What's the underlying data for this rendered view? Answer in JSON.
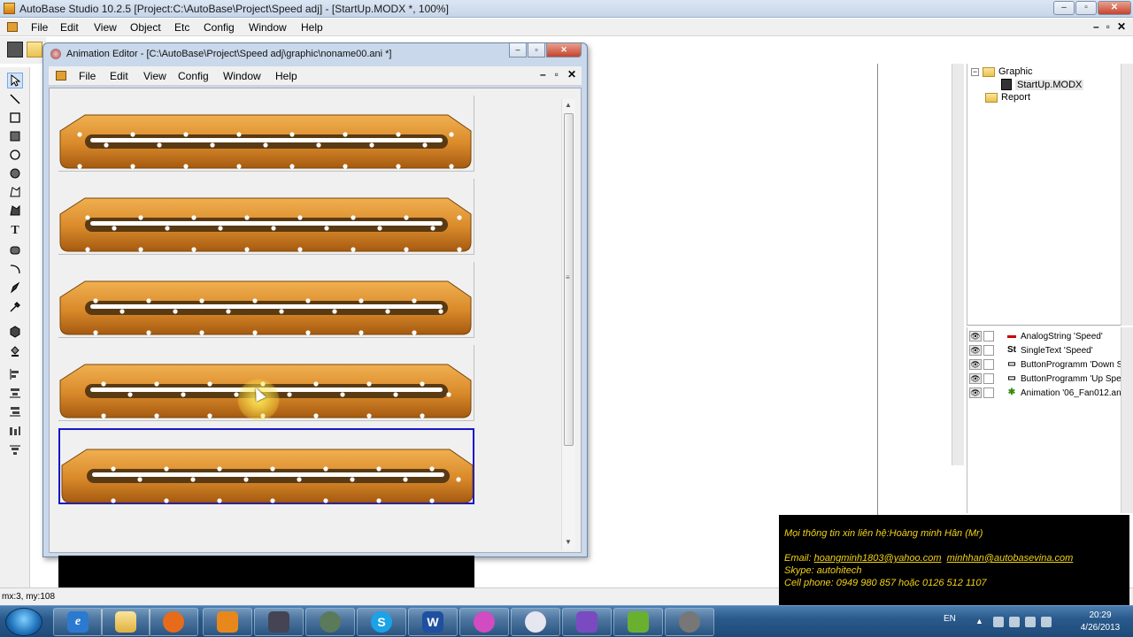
{
  "main_window": {
    "title": "AutoBase Studio 10.2.5 [Project:C:\\AutoBase\\Project\\Speed adj] - [StartUp.MODX *, 100%]",
    "controls": {
      "minimize": "–",
      "maximize": "▫",
      "close": "✕"
    }
  },
  "main_menu": {
    "items": [
      "File",
      "Edit",
      "View",
      "Object",
      "Etc",
      "Config",
      "Window",
      "Help"
    ],
    "mdi_controls": {
      "minimize": "–",
      "restore": "▫",
      "close": "✕"
    }
  },
  "tools": [
    "arrow-icon",
    "line-icon",
    "rectangle-icon",
    "filled-rectangle-icon",
    "ellipse-icon",
    "filled-ellipse-icon",
    "polygon-icon",
    "filled-polygon-icon",
    "text-icon",
    "rounded-rect-icon",
    "arc-icon",
    "pen-icon",
    "dropper-icon",
    "cube-icon",
    "fill-icon",
    "align-left-icon",
    "align-center-icon",
    "align-right-icon",
    "distribute-icon",
    "align-bottom-icon"
  ],
  "tool_glyphs": {
    "text": "T"
  },
  "project_tree": {
    "graphic_label": "Graphic",
    "startup_label": "StartUp.MODX",
    "report_label": "Report",
    "expander": "−"
  },
  "layers": [
    {
      "icon": "▬",
      "label": "AnalogString 'Speed'"
    },
    {
      "icon": "St",
      "label": "SingleText 'Speed'"
    },
    {
      "icon": "▭",
      "label": "ButtonProgramm 'Down S"
    },
    {
      "icon": "▭",
      "label": "ButtonProgramm 'Up Spe"
    },
    {
      "icon": "✱",
      "label": "Animation '06_Fan012.an"
    }
  ],
  "layer_eye": "👁",
  "animation_editor": {
    "title": "Animation Editor - [C:\\AutoBase\\Project\\Speed adj\\graphic\\noname00.ani *]",
    "controls": {
      "minimize": "–",
      "maximize": "▫",
      "close": "✕"
    },
    "menu": [
      "File",
      "Edit",
      "View",
      "Config",
      "Window",
      "Help"
    ],
    "mdi_controls": {
      "minimize": "–",
      "restore": "▫",
      "close": "✕"
    },
    "scroll_up": "▲",
    "scroll_down": "▼",
    "mid_grip": "≡",
    "frame_count": 5,
    "selected_frame": 5
  },
  "colors": {
    "conveyor_light": "#f0b050",
    "conveyor_dark": "#a55a10",
    "conveyor_inner": "#5a3a12",
    "selection": "#1616c8",
    "contact_text": "#f2d21a"
  },
  "status_bar": {
    "text": "mx:3, my:108"
  },
  "contact": {
    "line1": "Mọi thông tin xin liên hệ:Hoàng minh Hân (Mr)",
    "email_label": "Email: ",
    "email1": "hoangminh1803@yahoo.com",
    "email2": "minhhan@autobasevina.com",
    "skype": "Skype: autohitech",
    "phone": "Cell phone: 0949 980 857 hoặc 0126 512 1107"
  },
  "taskbar": {
    "apps": [
      "ie-icon",
      "explorer-icon",
      "media-player-icon",
      "outlook-icon",
      "app-icon",
      "network-icon",
      "skype-icon",
      "word-icon",
      "paint-icon",
      "gauge-icon",
      "media-icon",
      "autobase-icon",
      "film-icon"
    ],
    "app_glyphs": {
      "ie": "e",
      "skype": "S",
      "word": "W"
    },
    "language": "EN",
    "time": "20:29",
    "date": "4/26/2013"
  }
}
